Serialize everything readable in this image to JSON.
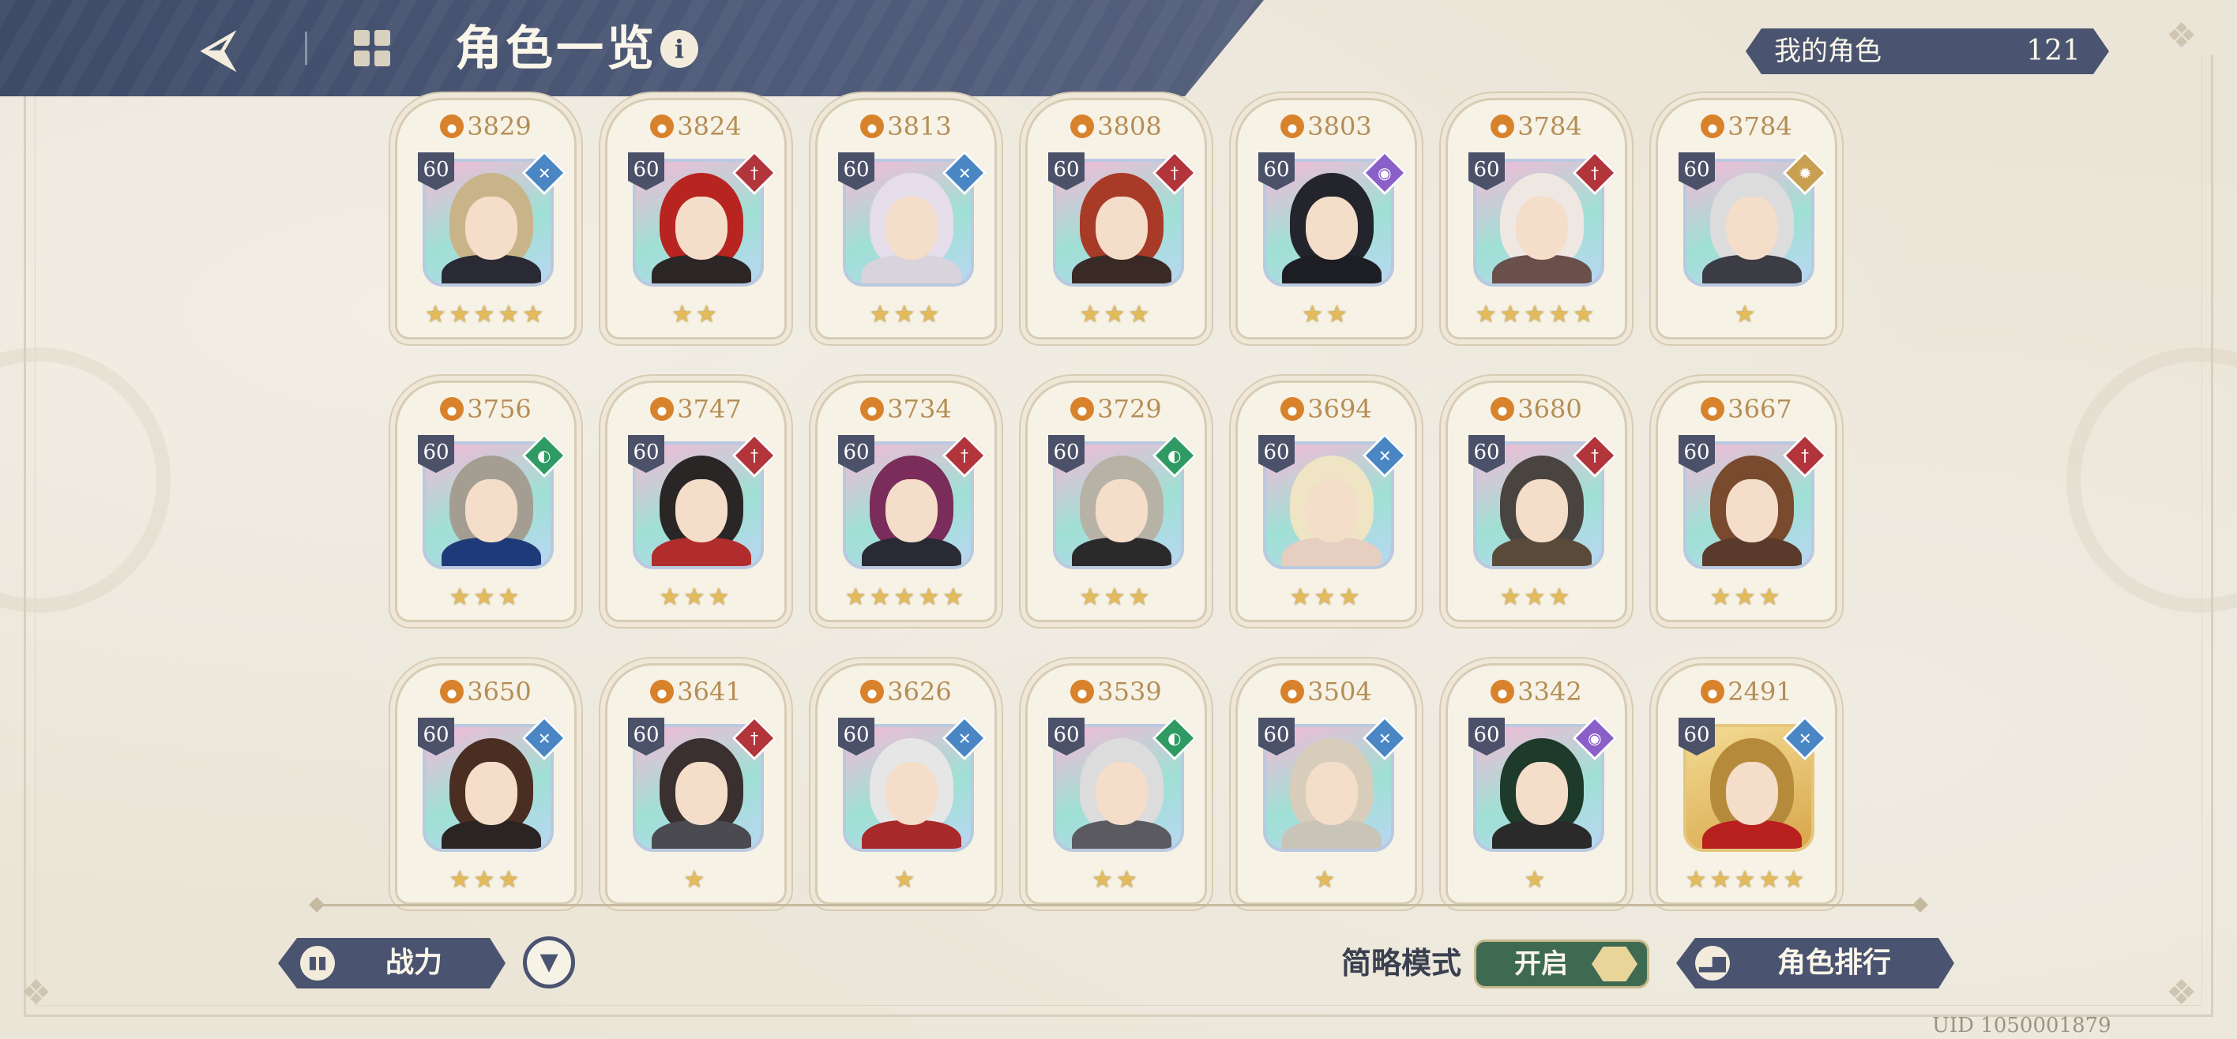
{
  "header": {
    "title": "角色一览",
    "back_icon": "back-arrow-icon",
    "menu_icon": "grid-menu-icon",
    "info_icon": "info-icon"
  },
  "counter": {
    "label": "我的角色",
    "value": "121"
  },
  "characters": [
    {
      "power": "3829",
      "level": "60",
      "element": "ice",
      "stars": 5,
      "hair": "#c9b48a",
      "outfit": "#2a2a34"
    },
    {
      "power": "3824",
      "level": "60",
      "element": "blade",
      "stars": 2,
      "hair": "#b8241f",
      "outfit": "#2c2626"
    },
    {
      "power": "3813",
      "level": "60",
      "element": "ice",
      "stars": 3,
      "hair": "#e6ddea",
      "outfit": "#d9d4dc"
    },
    {
      "power": "3808",
      "level": "60",
      "element": "blade",
      "stars": 3,
      "hair": "#a83a28",
      "outfit": "#3a2a26"
    },
    {
      "power": "3803",
      "level": "60",
      "element": "arcane",
      "stars": 2,
      "hair": "#24242c",
      "outfit": "#1d1d24"
    },
    {
      "power": "3784",
      "level": "60",
      "element": "blade",
      "stars": 5,
      "hair": "#efe7e2",
      "outfit": "#6b4f4a"
    },
    {
      "power": "3784",
      "level": "60",
      "element": "light",
      "stars": 1,
      "hair": "#dcdcdc",
      "outfit": "#3c3c44"
    },
    {
      "power": "3756",
      "level": "60",
      "element": "wind",
      "stars": 3,
      "hair": "#a49e92",
      "outfit": "#1f3a78"
    },
    {
      "power": "3747",
      "level": "60",
      "element": "blade",
      "stars": 3,
      "hair": "#2a2626",
      "outfit": "#b12c2c"
    },
    {
      "power": "3734",
      "level": "60",
      "element": "blade",
      "stars": 5,
      "hair": "#7a2c5a",
      "outfit": "#2a2a34"
    },
    {
      "power": "3729",
      "level": "60",
      "element": "wind",
      "stars": 3,
      "hair": "#b7b2a6",
      "outfit": "#2a2a2a"
    },
    {
      "power": "3694",
      "level": "60",
      "element": "ice",
      "stars": 3,
      "hair": "#efe4c4",
      "outfit": "#e6cfc0"
    },
    {
      "power": "3680",
      "level": "60",
      "element": "blade",
      "stars": 3,
      "hair": "#4a4440",
      "outfit": "#5a4a3a"
    },
    {
      "power": "3667",
      "level": "60",
      "element": "blade",
      "stars": 3,
      "hair": "#7a4a2e",
      "outfit": "#5a3a2a"
    },
    {
      "power": "3650",
      "level": "60",
      "element": "ice",
      "stars": 3,
      "hair": "#4a2e22",
      "outfit": "#2a2424"
    },
    {
      "power": "3641",
      "level": "60",
      "element": "blade",
      "stars": 1,
      "hair": "#3a3030",
      "outfit": "#4a4a50"
    },
    {
      "power": "3626",
      "level": "60",
      "element": "ice",
      "stars": 1,
      "hair": "#e6e6e6",
      "outfit": "#a82a2a"
    },
    {
      "power": "3539",
      "level": "60",
      "element": "wind",
      "stars": 2,
      "hair": "#dcdcdc",
      "outfit": "#5a5a60"
    },
    {
      "power": "3504",
      "level": "60",
      "element": "ice",
      "stars": 1,
      "hair": "#d8cdbb",
      "outfit": "#c9c4b8"
    },
    {
      "power": "3342",
      "level": "60",
      "element": "arcane",
      "stars": 1,
      "hair": "#1e3a2a",
      "outfit": "#2a2a2a"
    },
    {
      "power": "2491",
      "level": "60",
      "element": "ice",
      "stars": 5,
      "hair": "#b58a3a",
      "outfit": "#b8201e",
      "gold": true
    }
  ],
  "element_symbols": {
    "ice": "✕",
    "blade": "†",
    "wind": "◐",
    "arcane": "◉",
    "light": "✹"
  },
  "footer": {
    "sort_label": "战力",
    "sort_icon": "bar-chart-icon",
    "filter_icon": "filter-icon",
    "simple_mode_label": "简略模式",
    "toggle_label": "开启",
    "ranking_label": "角色排行",
    "ranking_icon": "ranking-icon",
    "uid": "UID 1050001879"
  }
}
